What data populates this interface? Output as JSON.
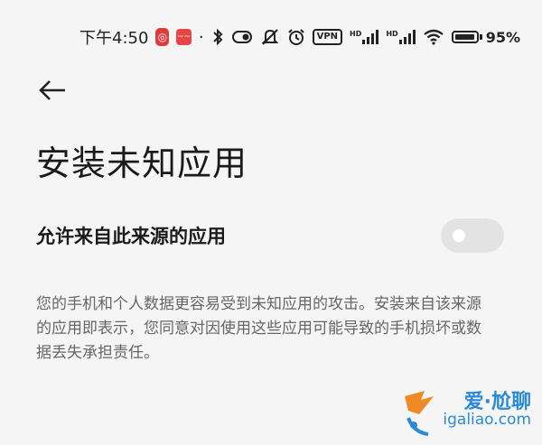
{
  "status_bar": {
    "time": "下午4:50",
    "app_badge_1": "◎",
    "app_badge_2": "~~",
    "dot": "·",
    "vpn_label": "VPN",
    "hd_label_1": "HD",
    "hd_label_2": "HD",
    "battery_percent": "95%",
    "battery_level": 0.95
  },
  "page": {
    "title": "安装未知应用"
  },
  "setting": {
    "label": "允许来自此来源的应用",
    "enabled": false
  },
  "description": "您的手机和个人数据更容易受到未知应用的攻击。安装来自该来源的应用即表示，您同意对因使用这些应用可能导致的手机损坏或数据丢失承担责任。",
  "watermark": {
    "line1": "爱·尬聊",
    "line2": "igaliao.com"
  },
  "colors": {
    "background": "#f5f5f5",
    "toggle_off": "#e3e3e3",
    "watermark": "#2a8ad8"
  }
}
